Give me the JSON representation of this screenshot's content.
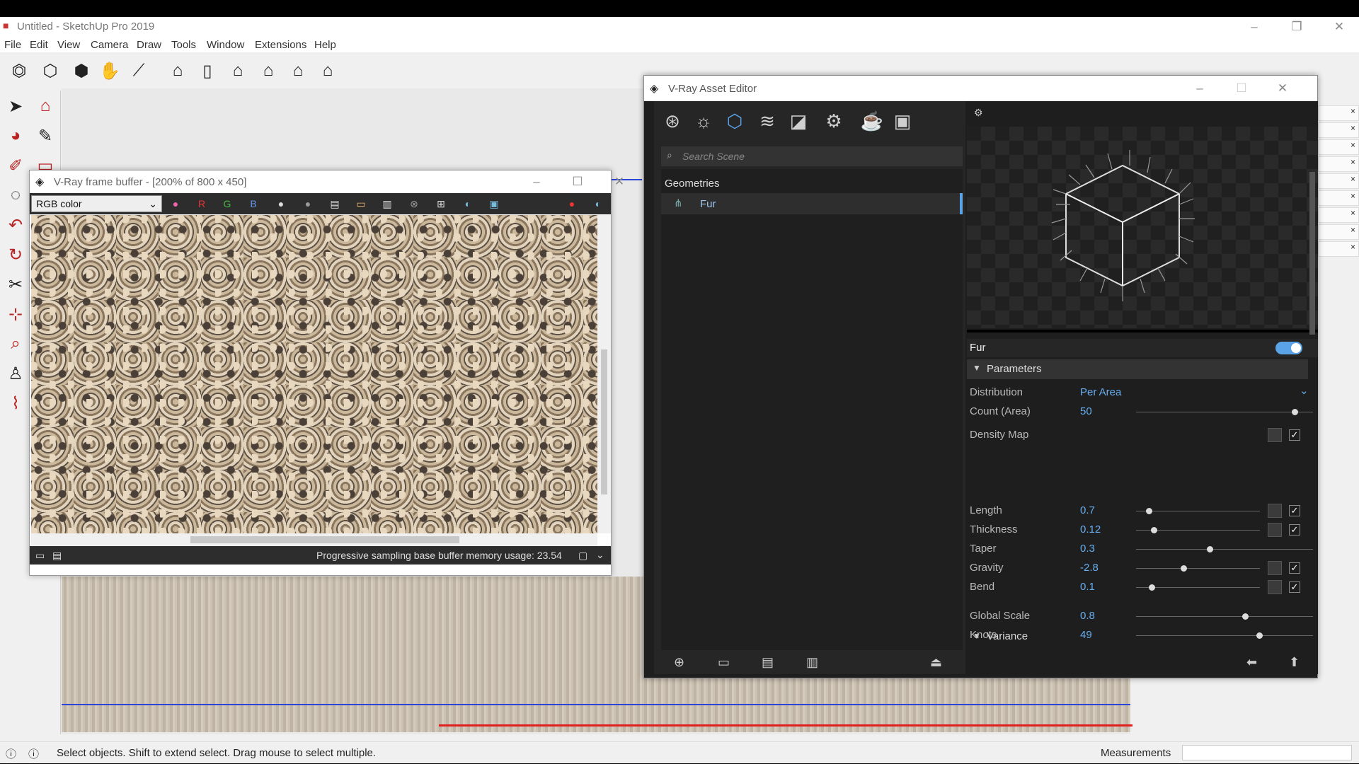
{
  "app": {
    "title": "Untitled - SketchUp Pro 2019",
    "menu": [
      "File",
      "Edit",
      "View",
      "Camera",
      "Draw",
      "Tools",
      "Window",
      "Extensions",
      "Help"
    ]
  },
  "toolbar_icons": [
    "section-icon",
    "box-icon",
    "box2-icon",
    "hand-icon",
    "eraser-icon",
    "house-icon",
    "door-icon",
    "home-icon",
    "store-icon",
    "house-outline-icon",
    "warehouse-icon"
  ],
  "left_tools": [
    "select-icon",
    "component-icon",
    "paint-icon",
    "eraser-icon",
    "pencil-icon",
    "rectangle-icon",
    "circle-icon",
    "arc-icon",
    "offset-icon",
    "move-icon",
    "rotate-icon",
    "scale-icon",
    "tape-icon",
    "protractor-icon",
    "axes-icon",
    "orbit-icon",
    "zoom-icon",
    "zoomext-icon",
    "walk-icon",
    "look-icon",
    "footprint-icon",
    "position-icon"
  ],
  "status": {
    "message": "Select objects. Shift to extend select. Drag mouse to select multiple.",
    "measurements": "Measurements"
  },
  "vfb": {
    "title": "V-Ray frame buffer - [200% of 800 x 450]",
    "channel": "RGB color",
    "channel_letters": [
      "R",
      "G",
      "B"
    ],
    "bottom_message": "Progressive sampling base buffer memory usage: 23.54"
  },
  "asset_editor": {
    "title": "V-Ray Asset Editor",
    "search_placeholder": "Search Scene",
    "category": "Geometries",
    "item": "Fur",
    "fur_label": "Fur",
    "fur_enabled": true,
    "parameters_label": "Parameters",
    "variance_label": "Variance",
    "distribution_label": "Distribution",
    "distribution_value": "Per Area",
    "density_map_label": "Density Map",
    "params": [
      {
        "label": "Count (Area)",
        "value": "50",
        "level": 0.88,
        "map": false
      },
      {
        "label": "Length",
        "value": "0.7",
        "level": 0.08,
        "map": true
      },
      {
        "label": "Thickness",
        "value": "0.12",
        "level": 0.12,
        "map": true
      },
      {
        "label": "Taper",
        "value": "0.3",
        "level": 0.4,
        "map": false
      },
      {
        "label": "Gravity",
        "value": "-2.8",
        "level": 0.36,
        "map": true
      },
      {
        "label": "Bend",
        "value": "0.1",
        "level": 0.1,
        "map": true
      },
      {
        "label": "Global Scale",
        "value": "0.8",
        "level": 0.6,
        "map": false
      },
      {
        "label": "Knots",
        "value": "49",
        "level": 0.68,
        "map": false
      }
    ],
    "colors": {
      "accent": "#5aa3e6",
      "value": "#67aef0"
    }
  }
}
